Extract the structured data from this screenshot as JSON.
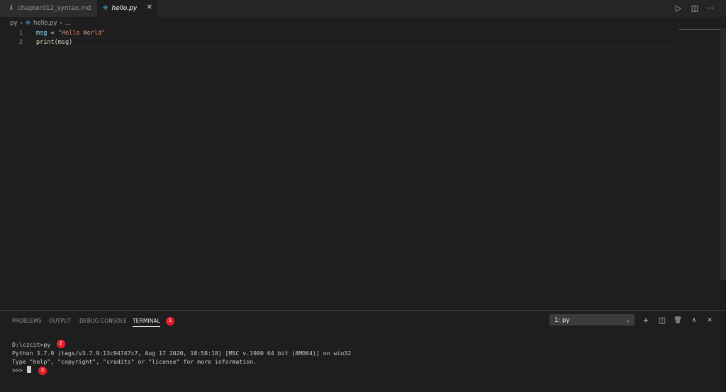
{
  "tabs": [
    {
      "label": "chapter012_syntax.md",
      "icon": "markdown-file-icon",
      "active": false
    },
    {
      "label": "hello.py",
      "icon": "python-file-icon",
      "active": true,
      "close": "✕"
    }
  ],
  "toolbar": {
    "run": "▷",
    "split": "◫",
    "more": "···"
  },
  "breadcrumb": {
    "folder": "py",
    "sep": "›",
    "file": "hello.py",
    "rest": "..."
  },
  "editor": {
    "lines": [
      {
        "num": "1",
        "var": "msg",
        "op": " = ",
        "str": "\"Hello World\""
      },
      {
        "num": "2",
        "fn": "print",
        "rest": "(msg)"
      }
    ]
  },
  "panel": {
    "tabs": [
      "PROBLEMS",
      "OUTPUT",
      "DEBUG CONSOLE",
      "TERMINAL"
    ],
    "active_tab": "TERMINAL",
    "terminal_select": "1: py",
    "icons": {
      "add": "+",
      "split": "◫",
      "trash": "🗑",
      "maximize": "∧",
      "close": "✕"
    }
  },
  "terminal": {
    "lines": [
      "D:\\czcit>py",
      "Python 3.7.9 (tags/v3.7.9:13c94747c7, Aug 17 2020, 18:58:18) [MSC v.1900 64 bit (AMD64)] on win32",
      "Type \"help\", \"copyright\", \"credits\" or \"license\" for more information.",
      ">>> "
    ]
  },
  "annotations": [
    "1",
    "2",
    "3"
  ],
  "colors": {
    "accent_badge": "#e81e2d",
    "string": "#ce9178",
    "function": "#dcdcaa",
    "variable": "#9cdcfe"
  }
}
